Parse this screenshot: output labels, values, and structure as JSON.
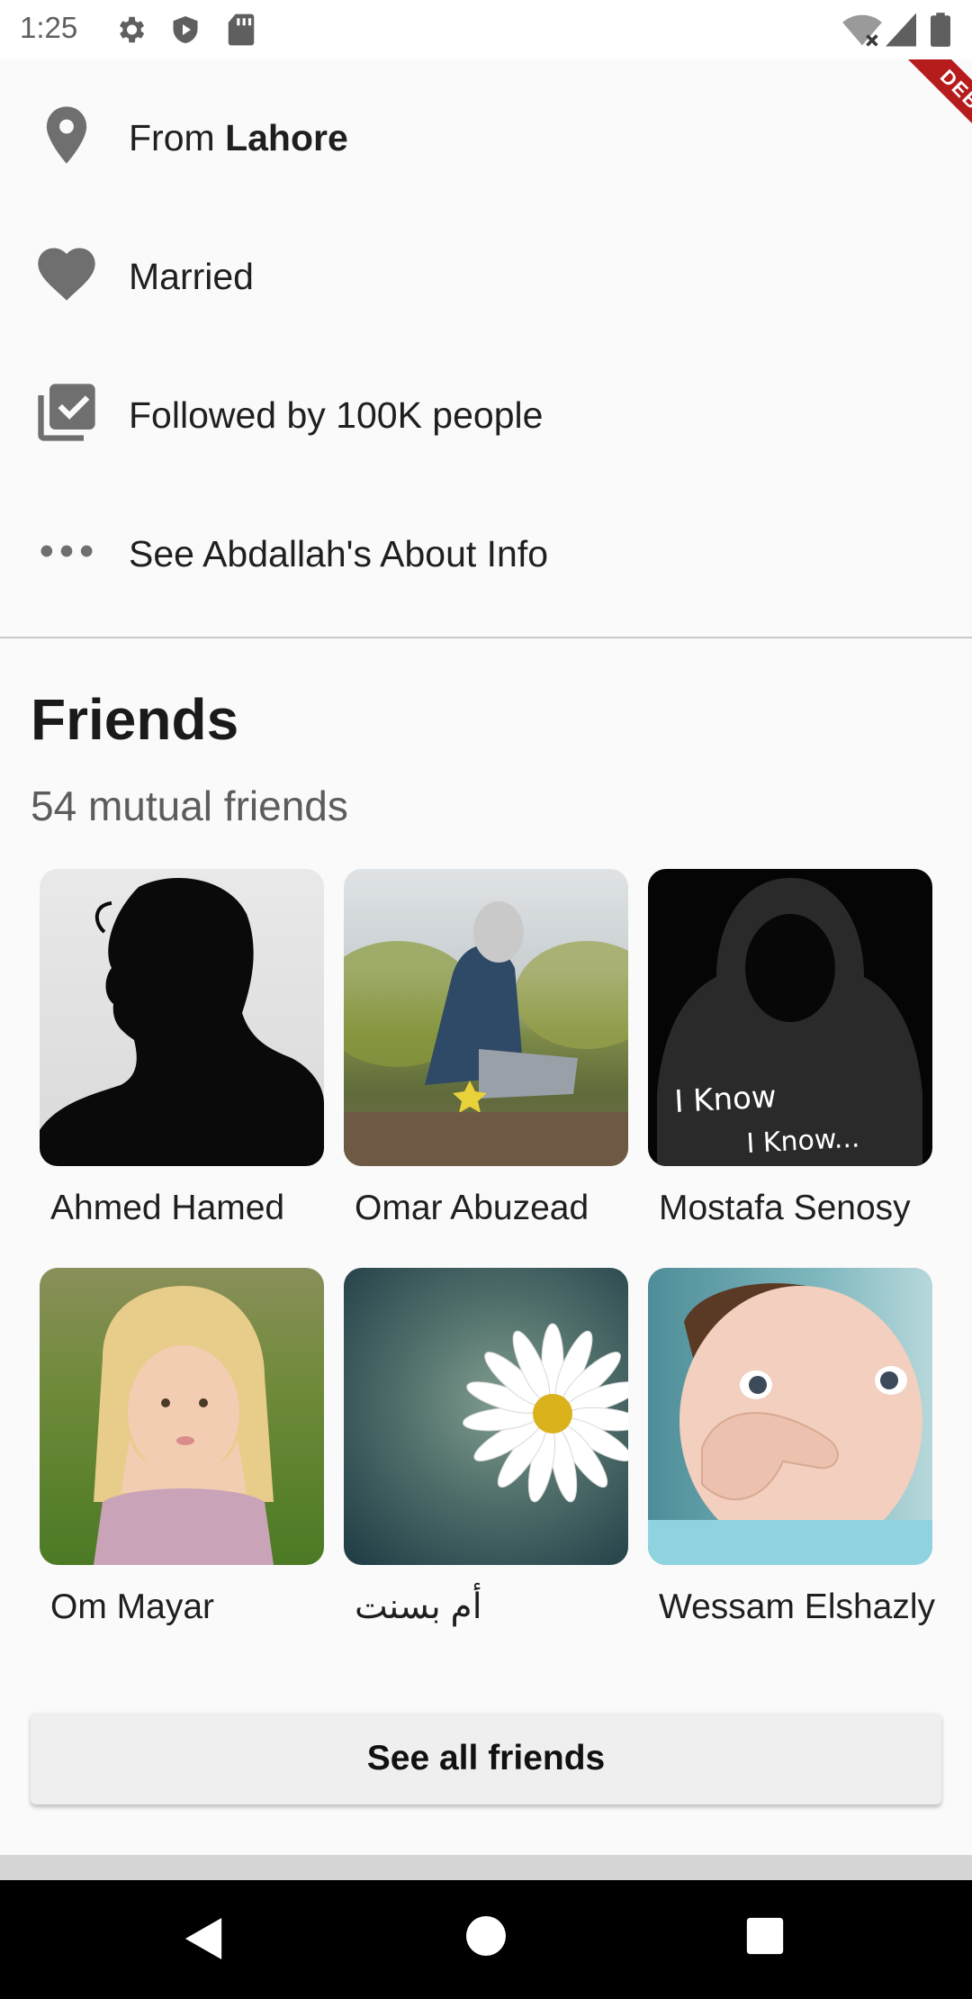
{
  "status_bar": {
    "time": "1:25",
    "left_icons": [
      "settings-icon",
      "shield-play-icon",
      "sd-card-icon"
    ],
    "right_icons": [
      "wifi-off-icon",
      "signal-icon",
      "battery-icon"
    ]
  },
  "debug_banner": {
    "label": "DEBUG"
  },
  "info": {
    "location_prefix": "From",
    "location_city": "Lahore",
    "relationship": "Married",
    "followers": "Followed by 100K people",
    "about": "See Abdallah's About Info"
  },
  "friends": {
    "title": "Friends",
    "mutual": "54 mutual friends",
    "items": [
      {
        "name": "Ahmed Hamed"
      },
      {
        "name": "Omar Abuzead"
      },
      {
        "name": "Mostafa Senosy"
      },
      {
        "name": "Om Mayar"
      },
      {
        "name": "أم بسنت"
      },
      {
        "name": "Wessam Elshazly"
      }
    ],
    "see_all": "See all friends"
  },
  "colors": {
    "icon_gray": "#6f6f6f",
    "debug_red": "#b71c1c",
    "background": "#fafafa"
  }
}
